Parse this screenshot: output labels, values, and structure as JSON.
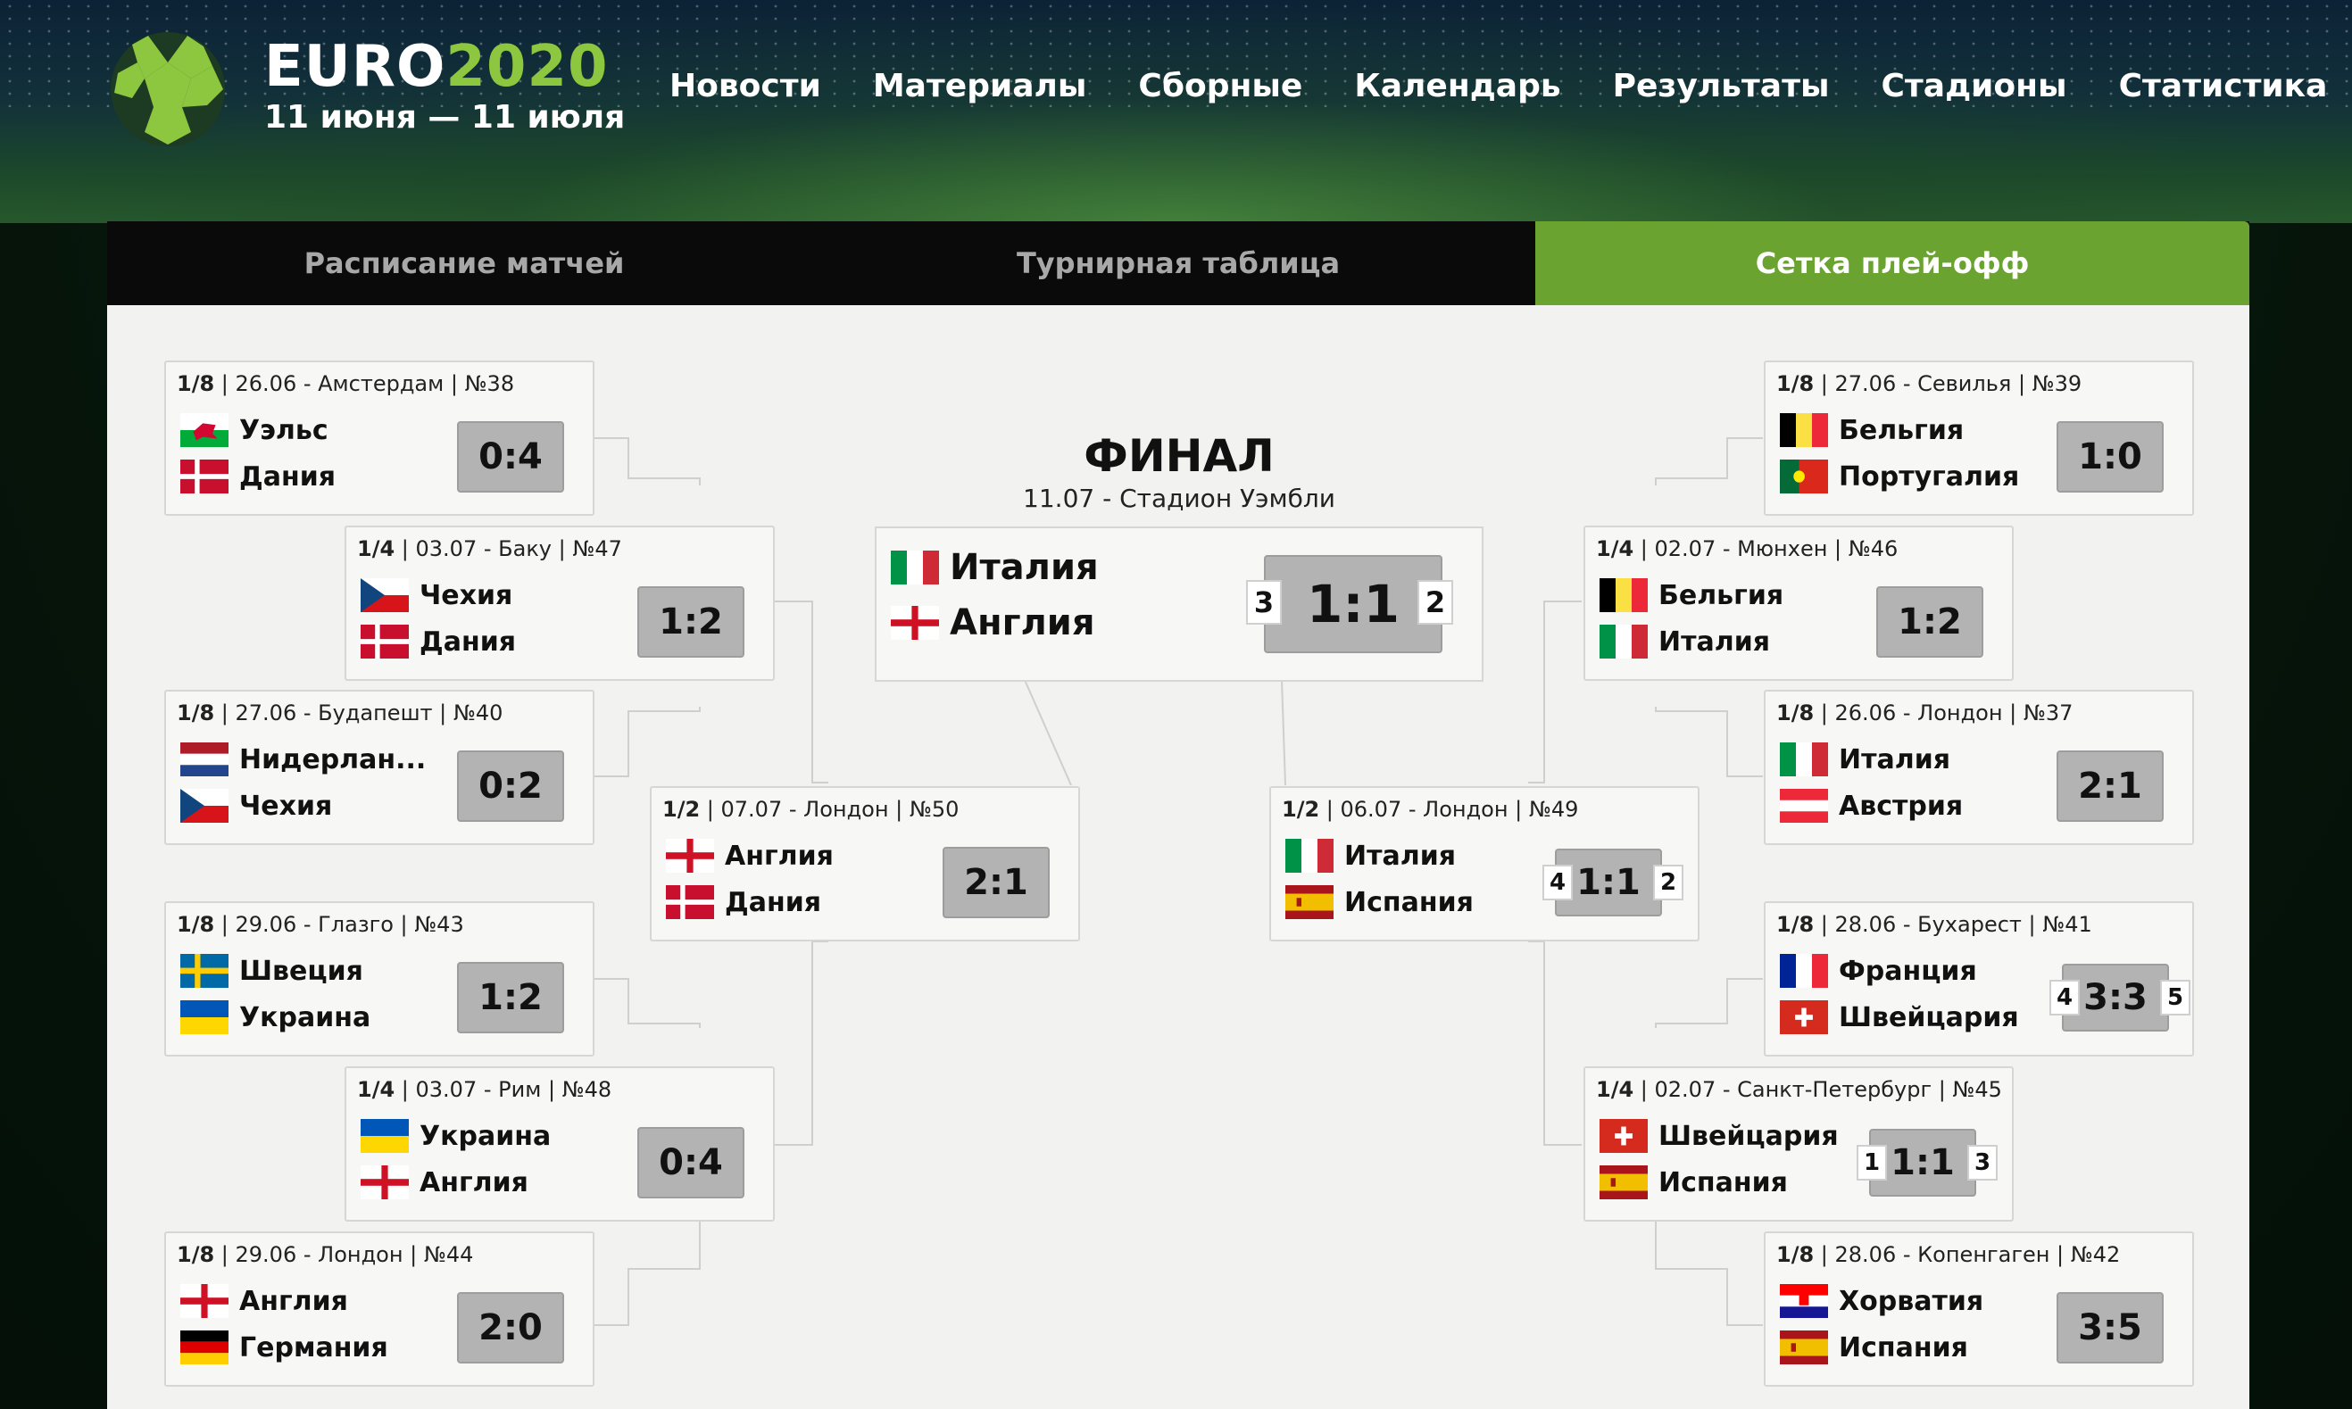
{
  "header": {
    "brand_main": "EURO",
    "brand_year": "2020",
    "dates": "11 июня — 11 июля",
    "nav": [
      "Новости",
      "Материалы",
      "Сборные",
      "Календарь",
      "Результаты",
      "Стадионы",
      "Статистика"
    ]
  },
  "tabs": [
    "Расписание матчей",
    "Турнирная таблица",
    "Сетка плей-офф"
  ],
  "active_tab": "Сетка плей-офф",
  "colors": {
    "accent": "#6aa32f",
    "score_bg": "#b3b3b3"
  },
  "final": {
    "title": "ФИНАЛ",
    "subtitle": "11.07 - Стадион Уэмбли",
    "team1": "Италия",
    "team2": "Англия",
    "score": "1:1",
    "pen1": "3",
    "pen2": "2",
    "flag1": "italy",
    "flag2": "england"
  },
  "matches": {
    "m38": {
      "stage": "1/8",
      "info": " | 26.06 - Амстердам | №38",
      "team1": "Уэльс",
      "team2": "Дания",
      "score": "0:4",
      "flag1": "wales",
      "flag2": "denmark"
    },
    "m47": {
      "stage": "1/4",
      "info": " | 03.07 - Баку | №47",
      "team1": "Чехия",
      "team2": "Дания",
      "score": "1:2",
      "flag1": "czech",
      "flag2": "denmark"
    },
    "m40": {
      "stage": "1/8",
      "info": " | 27.06 - Будапешт | №40",
      "team1": "Нидерлан...",
      "team2": "Чехия",
      "score": "0:2",
      "flag1": "netherlands",
      "flag2": "czech"
    },
    "m50": {
      "stage": "1/2",
      "info": " | 07.07 - Лондон | №50",
      "team1": "Англия",
      "team2": "Дания",
      "score": "2:1",
      "flag1": "england",
      "flag2": "denmark"
    },
    "m43": {
      "stage": "1/8",
      "info": " | 29.06 - Глазго | №43",
      "team1": "Швеция",
      "team2": "Украина",
      "score": "1:2",
      "flag1": "sweden",
      "flag2": "ukraine"
    },
    "m48": {
      "stage": "1/4",
      "info": " | 03.07 - Рим | №48",
      "team1": "Украина",
      "team2": "Англия",
      "score": "0:4",
      "flag1": "ukraine",
      "flag2": "england"
    },
    "m44": {
      "stage": "1/8",
      "info": " | 29.06 - Лондон | №44",
      "team1": "Англия",
      "team2": "Германия",
      "score": "2:0",
      "flag1": "england",
      "flag2": "germany"
    },
    "m39": {
      "stage": "1/8",
      "info": " | 27.06 - Севилья | №39",
      "team1": "Бельгия",
      "team2": "Португалия",
      "score": "1:0",
      "flag1": "belgium",
      "flag2": "portugal"
    },
    "m46": {
      "stage": "1/4",
      "info": " | 02.07 - Мюнхен | №46",
      "team1": "Бельгия",
      "team2": "Италия",
      "score": "1:2",
      "flag1": "belgium",
      "flag2": "italy"
    },
    "m37": {
      "stage": "1/8",
      "info": " | 26.06 - Лондон | №37",
      "team1": "Италия",
      "team2": "Австрия",
      "score": "2:1",
      "flag1": "italy",
      "flag2": "austria"
    },
    "m49": {
      "stage": "1/2",
      "info": " | 06.07 - Лондон | №49",
      "team1": "Италия",
      "team2": "Испания",
      "score": "1:1",
      "pen1": "4",
      "pen2": "2",
      "flag1": "italy",
      "flag2": "spain"
    },
    "m41": {
      "stage": "1/8",
      "info": " | 28.06 - Бухарест | №41",
      "team1": "Франция",
      "team2": "Швейцария",
      "score": "3:3",
      "pen1": "4",
      "pen2": "5",
      "flag1": "france",
      "flag2": "switzerland"
    },
    "m45": {
      "stage": "1/4",
      "info": " | 02.07 - Санкт-Петербург | №45",
      "team1": "Швейцария",
      "team2": "Испания",
      "score": "1:1",
      "pen1": "1",
      "pen2": "3",
      "flag1": "switzerland",
      "flag2": "spain"
    },
    "m42": {
      "stage": "1/8",
      "info": " | 28.06 - Копенгаген | №42",
      "team1": "Хорватия",
      "team2": "Испания",
      "score": "3:5",
      "flag1": "croatia",
      "flag2": "spain"
    }
  }
}
